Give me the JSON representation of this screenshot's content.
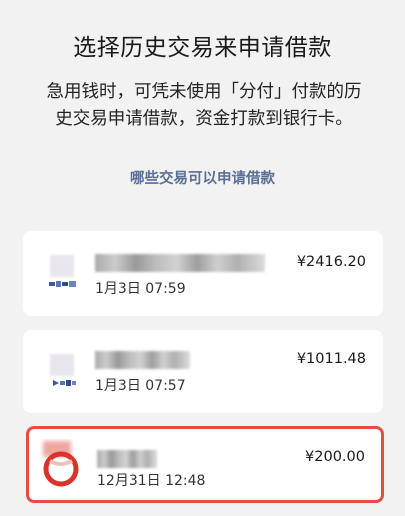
{
  "header": {
    "title": "选择历史交易来申请借款",
    "description": "急用钱时，可凭未使用「分付」付款的历史交易申请借款，资金打款到银行卡。",
    "link_label": "哪些交易可以申请借款"
  },
  "transactions": [
    {
      "amount": "¥2416.20",
      "date": "1月3日 07:59",
      "selected": false,
      "merchant_logo": "bank-logo-icon"
    },
    {
      "amount": "¥1011.48",
      "date": "1月3日 07:57",
      "selected": false,
      "merchant_logo": "bank-logo-icon"
    },
    {
      "amount": "¥200.00",
      "date": "12月31日 12:48",
      "selected": true,
      "merchant_logo": "red-circle-logo-icon"
    }
  ],
  "colors": {
    "accent_link": "#5a6f96",
    "selected_border": "#e84a45",
    "background": "#f2f2f2"
  }
}
